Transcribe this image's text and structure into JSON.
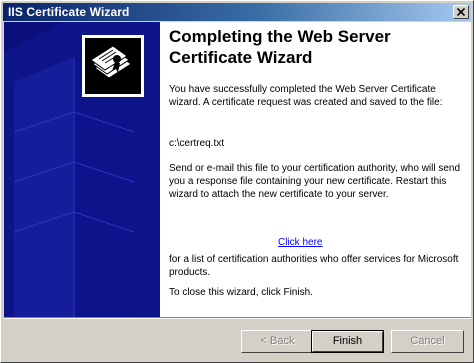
{
  "window": {
    "title": "IIS Certificate Wizard"
  },
  "heading": "Completing the Web Server Certificate Wizard",
  "paragraphs": {
    "intro": "You have successfully completed the Web Server Certificate wizard. A certificate request was created and saved to the file:",
    "path": "c:\\certreq.txt",
    "instructions": "Send or e-mail this file to your certification authority, who will send you a response file containing your new certificate. Restart this wizard to attach the new certificate to your server.",
    "link_text": "Click here",
    "authorities": "for a list of certification authorities who offer services for Microsoft products.",
    "close_note": "To close this wizard, click Finish."
  },
  "buttons": {
    "back": "< Back",
    "finish": "Finish",
    "cancel": "Cancel"
  },
  "colors": {
    "banner": "#0b0f7c",
    "titlebar_start": "#0a246a",
    "link": "#0000ff"
  },
  "icons": {
    "banner_logo": "certificate-icon",
    "close": "close-icon"
  }
}
